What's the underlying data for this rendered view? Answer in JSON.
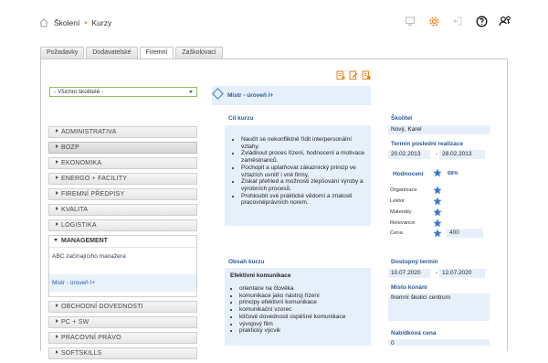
{
  "breadcrumb": {
    "home_icon": "home-icon",
    "items": [
      "Školení",
      "Kurzy"
    ]
  },
  "top_icons": [
    "monitor-icon",
    "settings-gear-icon",
    "logout-icon",
    "help-icon",
    "user-key-icon"
  ],
  "colors": {
    "accent_orange": "#e8821e",
    "link_blue": "#2a5a9a",
    "panel_blue": "#e6f0fa",
    "select_green": "#8fbf5a"
  },
  "tabs": [
    {
      "label": "Požadavky",
      "active": false
    },
    {
      "label": "Dodavatelské",
      "active": false
    },
    {
      "label": "Firemní",
      "active": true
    },
    {
      "label": "Zaškolovací",
      "active": false
    }
  ],
  "filter": {
    "selected": "- Všichni školitelé -"
  },
  "categories_before": [
    "ADMINISTRATIVA",
    "BOZP",
    "EKONOMIKA",
    "ENERGO + FACILITY",
    "FIREMNÍ PŘEDPISY",
    "KVALITA",
    "LOGISTIKA"
  ],
  "management": {
    "label": "MANAGEMENT",
    "courses": [
      "ABC začínajícího manažera",
      "Mistr - úroveň I+"
    ]
  },
  "categories_after": [
    "OBCHODNÍ DOVEDNOSTI",
    "PC + SW",
    "PRACOVNÍ PRÁVO",
    "SOFTSKILLS"
  ],
  "course": {
    "title": "Mistr - úroveň I+",
    "goal_title": "Cíl kurzu",
    "goals": [
      "Naučit se nekonfliktně řídit interpersonální vztahy.",
      "Zvládnout proces řízení, hodnocení a motivace zaměstnanců.",
      "Pochopit a uplatňovat zákaznický princip ve vztazích uvnitř i vně firmy.",
      "Získat přehled a možnosti zlepšování výroby a výrobních procesů.",
      "Prohloubit své praktické vědomí a znalosti pracovněprávních norem."
    ],
    "content_title": "Obsah kurzu",
    "content_subtitle": "Efektivní komunikace",
    "contents": [
      "orientace na člověka",
      "komunikace jako nástroj řízení",
      "principy efektivní komunikace",
      "komunikační vzorec",
      "klíčové dovednosti úspěšné komunikace",
      "vývojový film",
      "praktický výcvik"
    ]
  },
  "details": {
    "trainer_label": "Školitel",
    "trainer": "Nový, Karel",
    "last_label": "Termín poslední realizace",
    "last_from": "20.02.2013",
    "last_to": "28.02.2013",
    "dash": "-",
    "rating_label": "Hodnocení",
    "rating_percent": "68%",
    "rating_rows": [
      {
        "label": "Organizace",
        "value": ""
      },
      {
        "label": "Lektor",
        "value": ""
      },
      {
        "label": "Materiály",
        "value": ""
      },
      {
        "label": "Relevance",
        "value": ""
      },
      {
        "label": "Cena",
        "value": "400"
      }
    ],
    "available_label": "Dostupný termín",
    "avail_from": "10.07.2020",
    "avail_to": "12.07.2020",
    "place_label": "Místo konání",
    "place": "firemní školicí centrum",
    "price_label": "Nabídková cena",
    "price": "0"
  }
}
